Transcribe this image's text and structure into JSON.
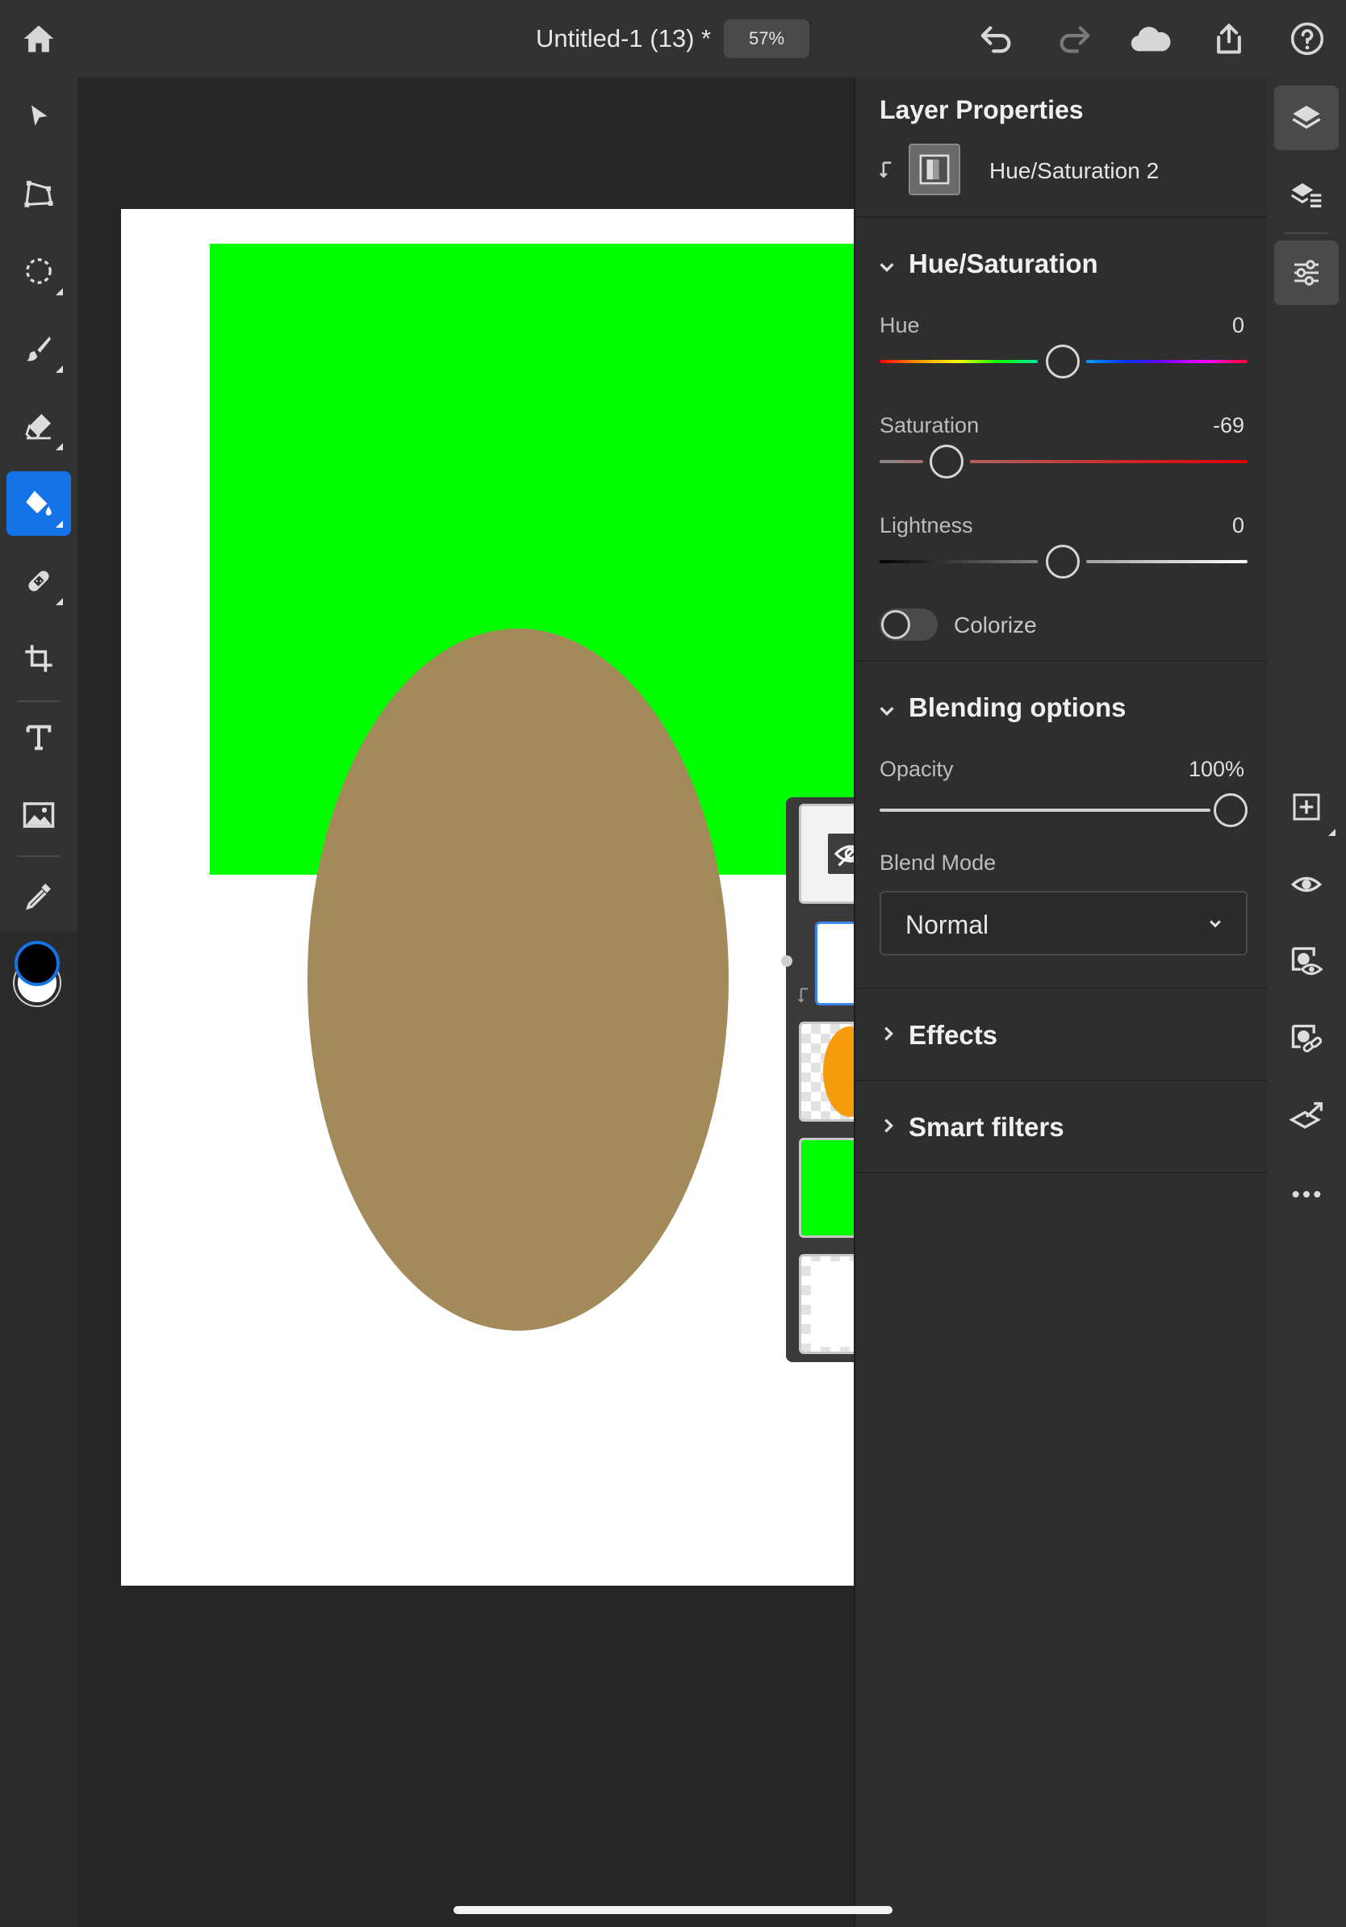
{
  "header": {
    "document_title": "Untitled-1 (13) *",
    "zoom_level": "57%"
  },
  "left_toolbar": {
    "active_tool": "paint-bucket",
    "tools": [
      "move",
      "transform",
      "lasso-select",
      "brush",
      "eraser",
      "paint-bucket",
      "healing",
      "crop",
      "type",
      "place-image",
      "eyedropper"
    ],
    "foreground_color": "#000000",
    "background_color": "#ffffff"
  },
  "canvas": {
    "background_color": "#ffffff",
    "shapes": [
      "green rectangle",
      "tan ellipse"
    ],
    "green_color": "#00ff00",
    "ellipse_color": "#a38a5a"
  },
  "layer_strip": {
    "layers": [
      "Hue/Saturation 2",
      "White fill",
      "Orange ellipse",
      "Green rectangle",
      "Background"
    ],
    "ellipse_thumb_color": "#f59b0c"
  },
  "properties": {
    "panel_title": "Layer Properties",
    "layer_name": "Hue/Saturation 2",
    "hue_saturation": {
      "section_title": "Hue/Saturation",
      "hue_label": "Hue",
      "hue_value": "0",
      "saturation_label": "Saturation",
      "saturation_value": "-69",
      "lightness_label": "Lightness",
      "lightness_value": "0",
      "colorize_label": "Colorize",
      "colorize_on": false
    },
    "blending": {
      "section_title": "Blending options",
      "opacity_label": "Opacity",
      "opacity_value": "100%",
      "blend_mode_label": "Blend Mode",
      "blend_mode_value": "Normal"
    },
    "effects_title": "Effects",
    "smart_filters_title": "Smart filters"
  },
  "right_strip": {
    "active_panel": "properties",
    "accent_color": "#1473e6"
  }
}
